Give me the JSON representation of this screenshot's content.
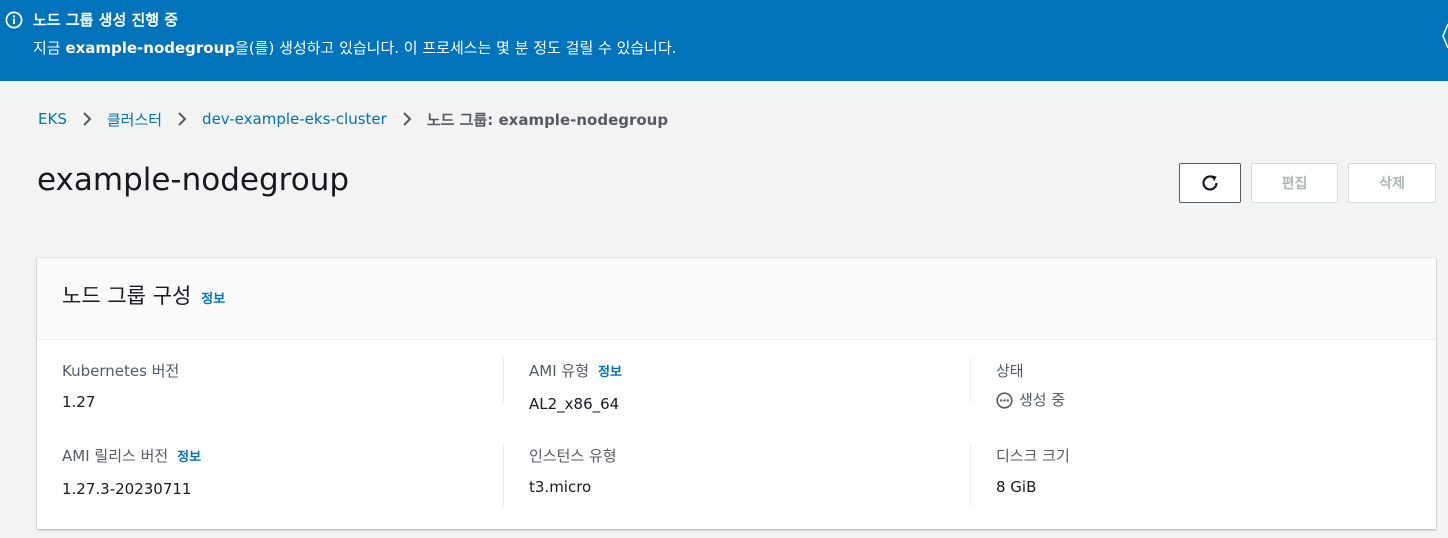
{
  "flash": {
    "icon": "info-circle-icon",
    "title": "노드 그룹 생성 진행 중",
    "message_prefix": "지금",
    "message_nodegroup": "example-nodegroup",
    "message_suffix": "을(를) 생성하고 있습니다. 이 프로세스는 몇 분 정도 걸릴 수 있습니다.",
    "color": "#0073bb"
  },
  "breadcrumb": {
    "items": [
      "EKS",
      "클러스터",
      "dev-example-eks-cluster"
    ],
    "current": "노드 그룹: example-nodegroup"
  },
  "page": {
    "title": "example-nodegroup"
  },
  "actions": {
    "refresh_icon": "refresh-icon",
    "edit_label": "편집",
    "delete_label": "삭제"
  },
  "panel": {
    "title": "노드 그룹 구성",
    "info_label": "정보",
    "fields": {
      "k8s_version": {
        "label": "Kubernetes 버전",
        "value": "1.27"
      },
      "ami_type": {
        "label": "AMI 유형",
        "info": "정보",
        "value": "AL2_x86_64"
      },
      "status": {
        "label": "상태",
        "value": "생성 중",
        "icon": "in-progress-icon"
      },
      "ami_release": {
        "label": "AMI 릴리스 버전",
        "info": "정보",
        "value": "1.27.3-20230711"
      },
      "instance_type": {
        "label": "인스턴스 유형",
        "value": "t3.micro"
      },
      "disk_size": {
        "label": "디스크 크기",
        "value": "8 GiB"
      }
    }
  },
  "colors": {
    "link": "#0073bb",
    "text": "#16191f",
    "secondary_text": "#545b64",
    "disabled": "#aab7b8",
    "background": "#f2f3f3"
  }
}
